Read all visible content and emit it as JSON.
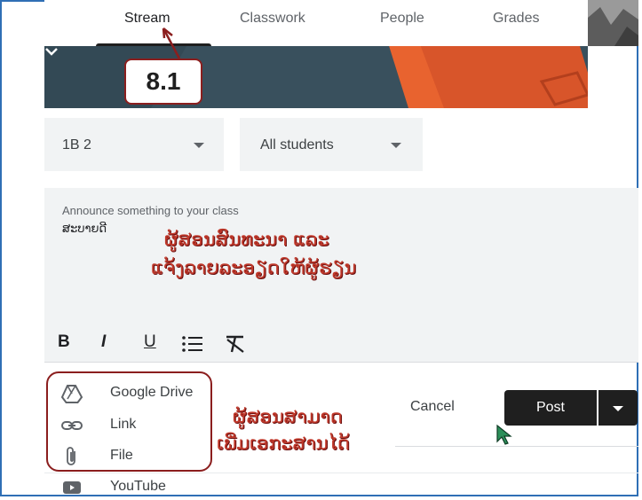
{
  "tabs": [
    {
      "label": "Stream"
    },
    {
      "label": "Classwork"
    },
    {
      "label": "People"
    },
    {
      "label": "Grades"
    }
  ],
  "callout": {
    "step": "8.1"
  },
  "selects": {
    "class": "1B 2",
    "audience": "All students"
  },
  "announce": {
    "placeholder": "Announce something to your class",
    "value": "ສະບາຍດີ"
  },
  "annotations": {
    "note1_line1": "ຜູ້ສອນສົນທະນາ ແລະ",
    "note1_line2": "ແຈ້ງລາຍລະອຽດໃຫ້ຜູ້ຮຽນ",
    "note2_line1": "ຜູ້ສອນສາມາດ",
    "note2_line2": "ເພີ່ມເອກະສານໄດ້"
  },
  "toolbar": {
    "bold": "B",
    "italic": "I",
    "underline": "U"
  },
  "attachments": [
    {
      "label": "Google Drive",
      "icon": "drive-icon"
    },
    {
      "label": "Link",
      "icon": "link-icon"
    },
    {
      "label": "File",
      "icon": "paperclip-icon"
    },
    {
      "label": "YouTube",
      "icon": "youtube-icon"
    }
  ],
  "actions": {
    "cancel": "Cancel",
    "post": "Post"
  },
  "colors": {
    "annotation": "#c0392b",
    "callout_border": "#8b1e1e",
    "banner": "#39505d",
    "banner_accent": "#e8632f",
    "post_bg": "#1f1f1f"
  }
}
